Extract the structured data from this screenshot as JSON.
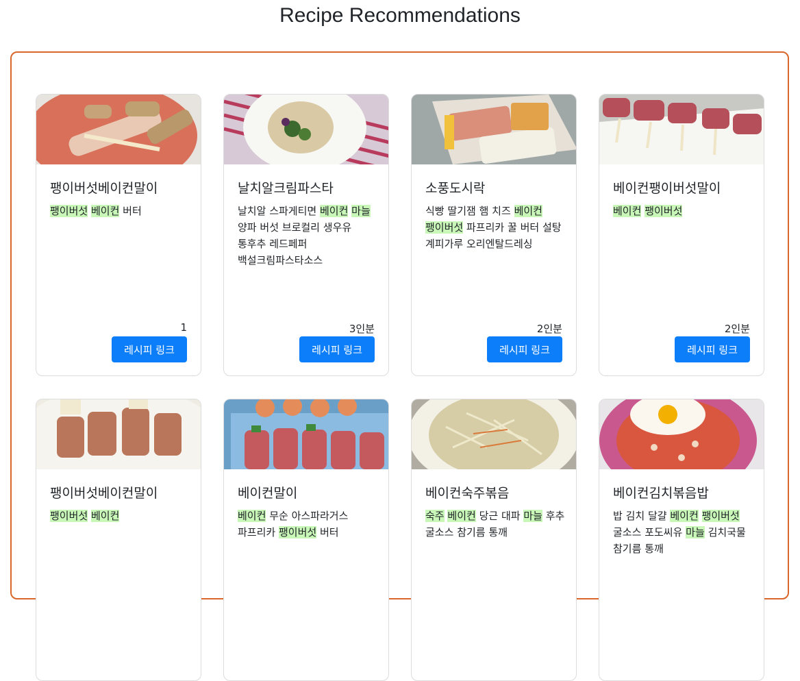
{
  "page": {
    "title": "Recipe Recommendations"
  },
  "button_label": "레시피 링크",
  "highlight_color": "#c8f7b8",
  "accent_color": "#0d7ef9",
  "border_color": "#d9662b",
  "cards": [
    {
      "title": "팽이버섯베이컨말이",
      "ingredients": [
        {
          "t": "팽이버섯",
          "h": true
        },
        {
          "t": "베이컨",
          "h": true
        },
        {
          "t": "버터",
          "h": false
        }
      ],
      "servings": "1",
      "image": "bacon-wrapped-enoki-on-red-plate"
    },
    {
      "title": "날치알크림파스타",
      "ingredients": [
        {
          "t": "날치알",
          "h": false
        },
        {
          "t": "스파게티면",
          "h": false
        },
        {
          "t": "베이컨",
          "h": true
        },
        {
          "t": "마늘",
          "h": true
        },
        {
          "t": "양파",
          "h": false
        },
        {
          "t": "버섯",
          "h": false
        },
        {
          "t": "브로컬리",
          "h": false
        },
        {
          "t": "생우유",
          "h": false
        },
        {
          "t": "통후추",
          "h": false
        },
        {
          "t": "레드페퍼",
          "h": false
        },
        {
          "t": "백설크림파스타소스",
          "h": false
        }
      ],
      "servings": "3인분",
      "image": "cream-pasta-on-white-plate"
    },
    {
      "title": "소풍도시락",
      "ingredients": [
        {
          "t": "식빵",
          "h": false
        },
        {
          "t": "딸기잼",
          "h": false
        },
        {
          "t": "햄",
          "h": false
        },
        {
          "t": "치즈",
          "h": false
        },
        {
          "t": "베이컨",
          "h": true
        },
        {
          "t": "팽이버섯",
          "h": true
        },
        {
          "t": "파프리카",
          "h": false
        },
        {
          "t": "꿀",
          "h": false
        },
        {
          "t": "버터",
          "h": false
        },
        {
          "t": "설탕",
          "h": false
        },
        {
          "t": "계피가루",
          "h": false
        },
        {
          "t": "오리엔탈드레싱",
          "h": false
        }
      ],
      "servings": "2인분",
      "image": "picnic-lunchbox"
    },
    {
      "title": "베이컨팽이버섯말이",
      "ingredients": [
        {
          "t": "베이컨",
          "h": true
        },
        {
          "t": "팽이버섯",
          "h": true
        }
      ],
      "servings": "2인분",
      "image": "bacon-rolls-on-white-dish"
    },
    {
      "title": "팽이버섯베이컨말이",
      "ingredients": [
        {
          "t": "팽이버섯",
          "h": true
        },
        {
          "t": "베이컨",
          "h": true
        }
      ],
      "servings": "",
      "image": "grilled-bacon-enoki-skewers"
    },
    {
      "title": "베이컨말이",
      "ingredients": [
        {
          "t": "베이컨",
          "h": true
        },
        {
          "t": "무순",
          "h": false
        },
        {
          "t": "아스파라거스",
          "h": false
        },
        {
          "t": "파프리카",
          "h": false
        },
        {
          "t": "팽이버섯",
          "h": true
        },
        {
          "t": "버터",
          "h": false
        }
      ],
      "servings": "",
      "image": "bacon-rolls-in-blue-tray"
    },
    {
      "title": "베이컨숙주볶음",
      "ingredients": [
        {
          "t": "숙주",
          "h": true
        },
        {
          "t": "베이컨",
          "h": true
        },
        {
          "t": "당근",
          "h": false
        },
        {
          "t": "대파",
          "h": false
        },
        {
          "t": "마늘",
          "h": true
        },
        {
          "t": "후추",
          "h": false
        },
        {
          "t": "굴소스",
          "h": false
        },
        {
          "t": "참기름",
          "h": false
        },
        {
          "t": "통깨",
          "h": false
        }
      ],
      "servings": "",
      "image": "stir-fried-bean-sprouts"
    },
    {
      "title": "베이컨김치볶음밥",
      "ingredients": [
        {
          "t": "밥",
          "h": false
        },
        {
          "t": "김치",
          "h": false
        },
        {
          "t": "달걀",
          "h": false
        },
        {
          "t": "베이컨",
          "h": true
        },
        {
          "t": "팽이버섯",
          "h": true
        },
        {
          "t": "굴소스",
          "h": false
        },
        {
          "t": "포도씨유",
          "h": false
        },
        {
          "t": "마늘",
          "h": true
        },
        {
          "t": "김치국물",
          "h": false
        },
        {
          "t": "참기름",
          "h": false
        },
        {
          "t": "통깨",
          "h": false
        }
      ],
      "servings": "",
      "image": "kimchi-fried-rice-with-egg"
    }
  ]
}
